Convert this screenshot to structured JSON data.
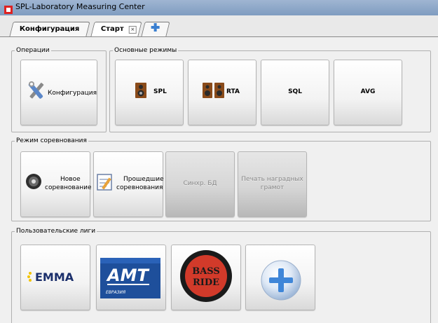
{
  "window": {
    "title": "SPL-Laboratory Measuring Center"
  },
  "tabs": [
    {
      "label": "Конфигурация"
    },
    {
      "label": "Старт",
      "close_icon": "close-box-icon"
    },
    {
      "label": "",
      "icon": "plus-tab-icon"
    }
  ],
  "operations": {
    "legend": "Операции",
    "config_button": {
      "label": "Конфигурация",
      "icon": "tools-icon"
    }
  },
  "modes": {
    "legend": "Основные режимы",
    "buttons": [
      {
        "label": "SPL",
        "icon": "speaker-icon"
      },
      {
        "label": "RTA",
        "icon": "speaker-pair-icon"
      },
      {
        "label": "SQL"
      },
      {
        "label": "AVG"
      }
    ]
  },
  "competition": {
    "legend": "Режим соревнования",
    "buttons": [
      {
        "line1": "Новое",
        "line2": "соревнование",
        "icon": "disc-icon"
      },
      {
        "line1": "Прошедшие",
        "line2": "соревнования",
        "icon": "notepad-icon"
      },
      {
        "label": "Синхр. БД",
        "disabled": true
      },
      {
        "line1": "Печать наградных",
        "line2": "грамот",
        "disabled": true
      }
    ]
  },
  "leagues": {
    "legend": "Пользовательские лиги",
    "items": [
      {
        "logo_text": "EMMA"
      },
      {
        "logo_text": "AMT",
        "logo_subtext": "ЕВРАЗИЯ"
      },
      {
        "logo_line1": "BASS",
        "logo_line2": "RIDE"
      },
      {
        "icon": "add-league-icon"
      }
    ]
  },
  "colors": {
    "title_bar": "#8ea7c9",
    "amt_blue": "#1e4f9b",
    "bass_ride_red": "#d23a2a",
    "emma_yellow": "#f2c300",
    "add_blue": "#3f86d8"
  }
}
